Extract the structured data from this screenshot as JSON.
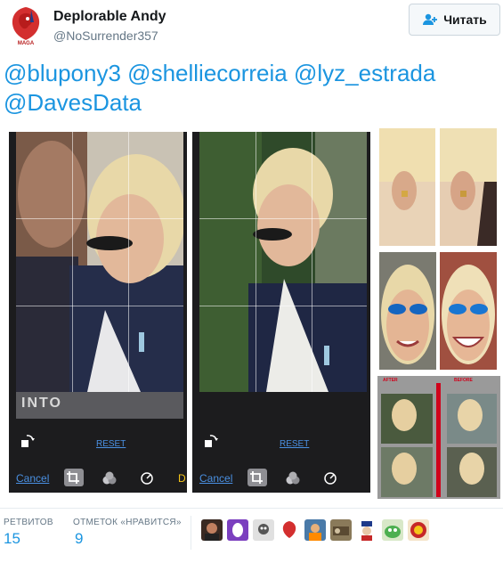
{
  "user": {
    "name": "Deplorable Andy",
    "handle": "@NoSurrender357",
    "avatar_text": "MAGA"
  },
  "follow_button": {
    "label": "Читать"
  },
  "tweet": {
    "mentions": [
      "@blupony3",
      "@shelliecorreia",
      "@lyz_estrada",
      "@DavesData"
    ]
  },
  "media": {
    "left_phone": {
      "reset_label": "RESET",
      "cancel_label": "Cancel",
      "bottom_text": "INTO"
    },
    "mid_phone": {
      "reset_label": "RESET",
      "cancel_label": "Cancel"
    },
    "collage": {
      "after_label": "AFTER",
      "before_label": "BEFORE"
    }
  },
  "stats": {
    "retweets_label": "РЕТВИТОВ",
    "retweets_count": "15",
    "likes_label": "ОТМЕТОК «НРАВИТСЯ»",
    "likes_count": "9"
  },
  "colors": {
    "link": "#1b95e0",
    "phone_bg": "#1c1c1e",
    "accent_red": "#d0021b"
  }
}
